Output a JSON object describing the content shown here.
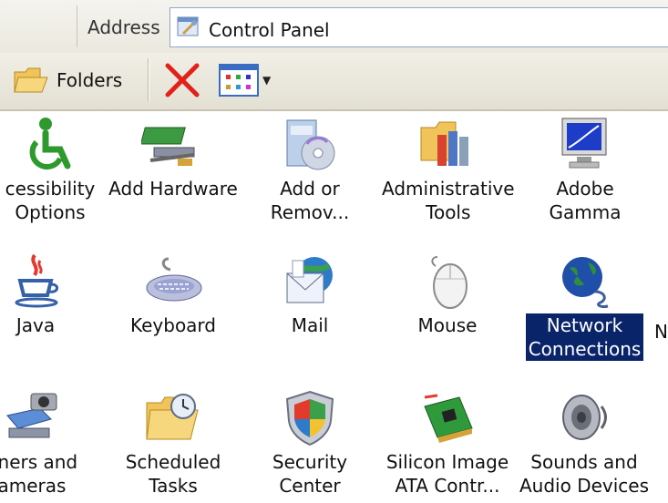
{
  "address_bar": {
    "label": "Address",
    "value": "Control Panel"
  },
  "toolbar": {
    "folders_label": "Folders"
  },
  "items": [
    {
      "label": "cessibility\nOptions"
    },
    {
      "label": "Add Hardware"
    },
    {
      "label": "Add or\nRemov..."
    },
    {
      "label": "Administrative\nTools"
    },
    {
      "label": "Adobe Gamma"
    },
    {
      "label": "Java"
    },
    {
      "label": "Keyboard"
    },
    {
      "label": "Mail"
    },
    {
      "label": "Mouse"
    },
    {
      "label": "Network\nConnections"
    },
    {
      "label": "nners and\nameras"
    },
    {
      "label": "Scheduled\nTasks"
    },
    {
      "label": "Security\nCenter"
    },
    {
      "label": "Silicon Image\nATA Contr..."
    },
    {
      "label": "Sounds and\nAudio Devices"
    }
  ],
  "partial_next_item": "N",
  "colors": {
    "selection": "#0a246a",
    "toolbar": "#ece9d8",
    "address_border": "#8fa7c8"
  }
}
